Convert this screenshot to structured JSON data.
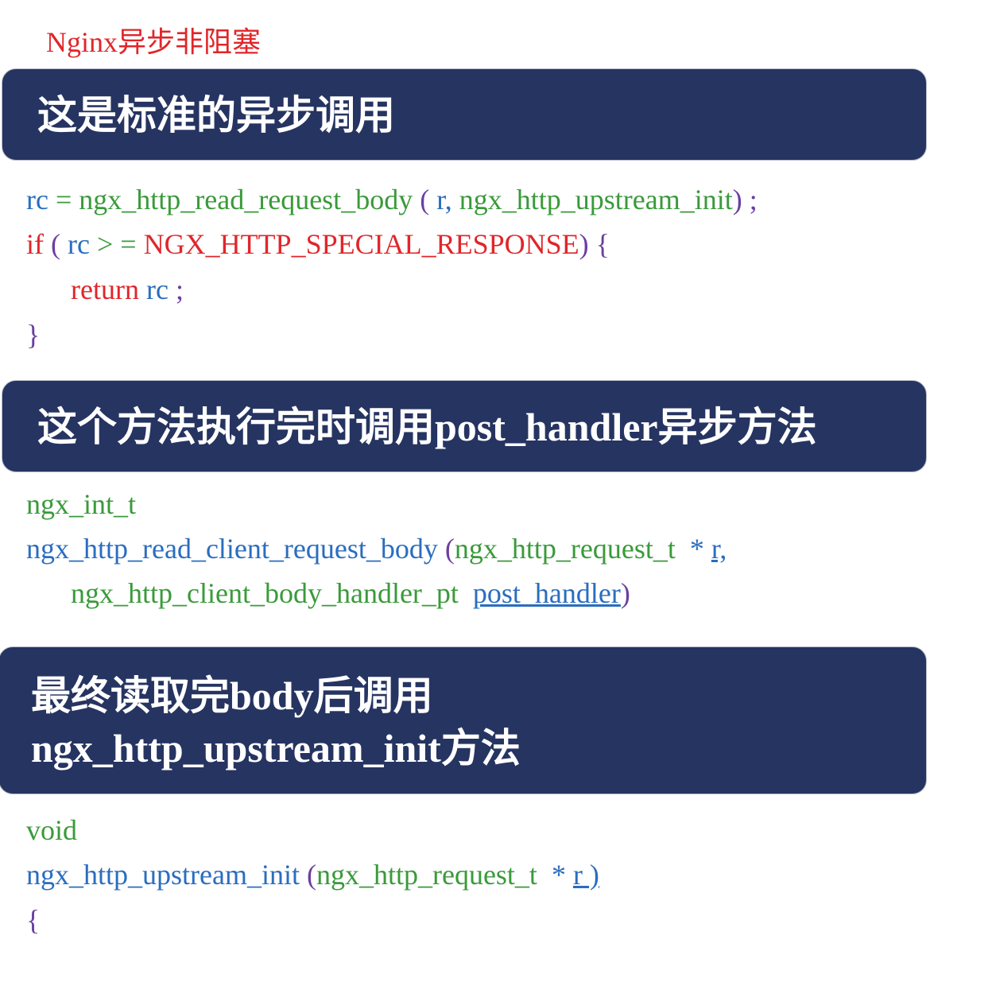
{
  "page_title": "Nginx异步非阻塞",
  "section1": {
    "heading": "这是标准的异步调用",
    "code": {
      "l1": {
        "rc": "rc",
        "eq": " = ",
        "fn": "ngx_http_read_request_body",
        "sp": " ",
        "open": "(",
        "r": " r,",
        "cb": " ngx_http_upstream_init",
        "close": ")",
        "semi": " ;"
      },
      "l2": {
        "kw": "if",
        "open": " (",
        "rc": " rc ",
        "op": "> = ",
        "const": "NGX_HTTP_SPECIAL_RESPONSE",
        "close": ")",
        "brace": " {"
      },
      "l3": {
        "kw": "return",
        "rc": " rc",
        "semi": " ;"
      },
      "l4": {
        "brace": "}"
      }
    }
  },
  "section2": {
    "heading_cn": "这个方法执行完时调用",
    "heading_fn": "post_handler",
    "heading_cn2": "异步方法",
    "code": {
      "l1": {
        "type": "ngx_int_t"
      },
      "l2": {
        "fn": "ngx_http_read_client_request_body",
        "open": " (",
        "type": "ngx_http_request_t",
        "star": "  * ",
        "arg": "r,"
      },
      "l3": {
        "type": "ngx_http_client_body_handler_pt",
        "arg": "post_handler",
        "close": ")"
      }
    }
  },
  "section3": {
    "heading_cn": "最终读取完",
    "heading_body": "body",
    "heading_cn2": "后调用",
    "heading_fn": "ngx_http_upstream_init",
    "heading_cn3": "方法",
    "code": {
      "l1": {
        "type": "void"
      },
      "l2": {
        "fn": "ngx_http_upstream_init",
        "open": " (",
        "type": "ngx_http_request_t",
        "star": "  * ",
        "arg": "r )"
      },
      "l3": {
        "brace": "{"
      }
    }
  },
  "colors": {
    "banner_bg": "#263461",
    "title_red": "#e0262a",
    "code_green": "#3a9a3a",
    "code_blue": "#2a6dbf",
    "code_purple": "#6b3fa0"
  }
}
